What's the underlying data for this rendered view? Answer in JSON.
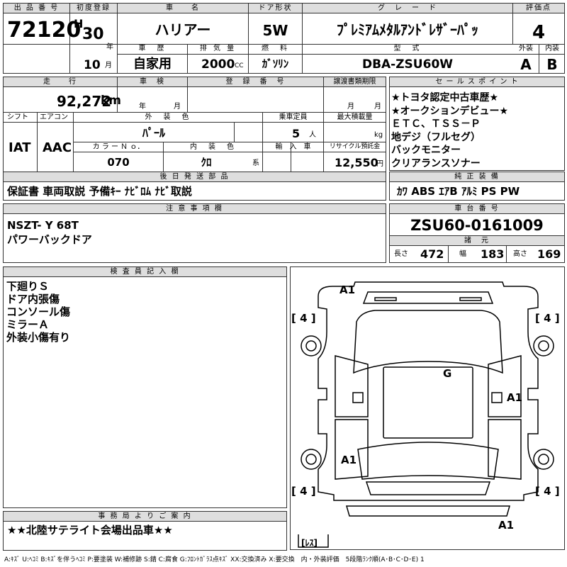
{
  "labels": {
    "lot_no": "出 品 番 号",
    "first_reg": "初度登録",
    "car_name": "車　　名",
    "door": "ドア形状",
    "grade": "グ　レ　ー　ド",
    "score": "評価点",
    "history": "車　歴",
    "displacement": "排 気 量",
    "fuel": "燃　料",
    "model": "型　式",
    "exterior": "外装",
    "interior": "内装",
    "mileage": "走　　行",
    "inspection": "車　検",
    "reg_no": "登　録　番　号",
    "transfer": "譲渡書類期限",
    "sales_points": "セ ー ル ス ポ イ ン ト",
    "shift": "シフト",
    "aircon": "エアコン",
    "ext_color": "外　装　色",
    "capacity": "乗車定員",
    "max_load": "最大積載量",
    "color_no": "カ ラ ー Ｎ ｏ．",
    "int_color": "内　装　色",
    "import": "輸　入　車",
    "recycle": "リサイクル預託金",
    "later_items": "後 日 発 送 部 品",
    "genuine": "純 正 装 備",
    "notes": "注 意 事 項 欄",
    "chassis": "車 台 番 号",
    "specs": "諸　元",
    "inspector": "検 査 員 記 入 欄",
    "office": "事 務 局 よ り ご 案 内"
  },
  "units": {
    "year": "年",
    "month": "月",
    "cc": "CC",
    "km": "km",
    "kg": "kg",
    "persons": "人",
    "yen": "円",
    "kei": "系",
    "length": "長さ",
    "width": "幅",
    "height": "高さ"
  },
  "lot_no": "72120",
  "era": "H",
  "reg_year": "30",
  "reg_month": "10",
  "car_name": "ハリアー",
  "door": "5W",
  "grade": "ﾌﾟﾚﾐｱﾑﾒﾀﾙｱﾝﾄﾞﾚｻﾞｰﾊﾟｯ",
  "score": "4",
  "history": "自家用",
  "displacement": "2000",
  "fuel": "ｶﾞｿﾘﾝ",
  "model": "DBA-ZSU60W",
  "exterior_grade": "A",
  "interior_grade": "B",
  "mileage": "92,272",
  "shift": "IAT",
  "aircon": "AAC",
  "ext_color": "ﾊﾟｰﾙ",
  "capacity": "5",
  "color_no": "070",
  "int_color": "ｸﾛ",
  "recycle": "12,550",
  "sales_points": [
    "★トヨタ認定中古車歴★",
    "★オークションデビュー★",
    "ＥＴＣ、ＴＳＳ－Ｐ",
    "地デジ（フルセグ）",
    "バックモニター",
    "クリアランスソナー"
  ],
  "later_items": "保証書 車両取説 予備ｷｰ ﾅﾋﾞﾛﾑ ﾅﾋﾞ取説",
  "genuine": "ｶﾜ ABS ｴｱB ｱﾙﾐ PS PW",
  "notes": [
    "NSZT- Y 68T",
    "パワーバックドア"
  ],
  "chassis_no": "ZSU60-0161009",
  "spec_length": "472",
  "spec_width": "183",
  "spec_height": "169",
  "inspector_notes": [
    "下廻りＳ",
    "ドア内張傷",
    "コンソール傷",
    "ミラーＡ",
    "外装小傷有り"
  ],
  "diagram": {
    "marks": [
      "A1",
      "G",
      "A1",
      "A1",
      "A1"
    ],
    "tires": [
      "[ 4 ]",
      "[ 4 ]",
      "[ 4 ]",
      "[ 4 ]"
    ],
    "spare": "[ﾚｽ]"
  },
  "office_message": "★★北陸サテライト会場出品車★★",
  "legend": "A:ｷｽﾞ U:ﾍｺﾐ B:ｷｽﾞを伴うﾍｺﾐ P:要塗装 W:補修跡 S:錆 C:腐食 G:ﾌﾛﾝﾄｶﾞﾗｽ点ｷｽﾞ XX:交換済み X:要交換　内・外装評価　5段階ﾗﾝｸ順(A･B･C･D･E) 1"
}
